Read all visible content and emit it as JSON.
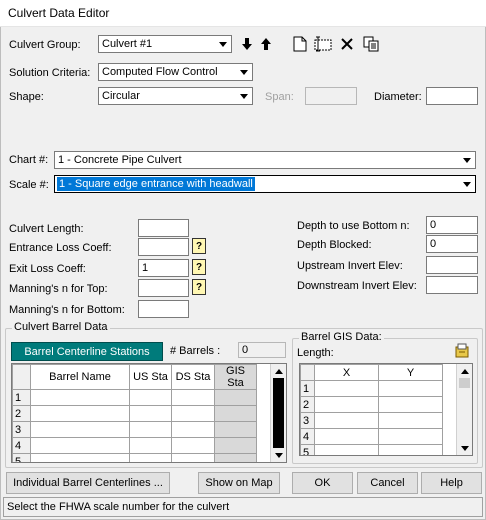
{
  "window": {
    "title": "Culvert Data Editor"
  },
  "culvert_group": {
    "label": "Culvert Group:",
    "value": "Culvert #1"
  },
  "toolbar": {
    "icons": [
      "arrow-down-icon",
      "arrow-up-icon",
      "new-document-icon",
      "rename-icon",
      "delete-icon",
      "copy-icon"
    ]
  },
  "solution_criteria": {
    "label": "Solution Criteria:",
    "value": "Computed Flow Control"
  },
  "shape": {
    "label": "Shape:",
    "value": "Circular"
  },
  "span": {
    "label": "Span:",
    "value": ""
  },
  "diameter": {
    "label": "Diameter:",
    "value": ""
  },
  "chart": {
    "label": "Chart #:",
    "value": "1 - Concrete Pipe Culvert"
  },
  "scale": {
    "label": "Scale #:",
    "value": "1 - Square edge entrance with headwall"
  },
  "fields_left": {
    "culvert_length": {
      "label": "Culvert Length:",
      "value": ""
    },
    "entrance_loss": {
      "label": "Entrance Loss Coeff:",
      "value": ""
    },
    "exit_loss": {
      "label": "Exit Loss Coeff:",
      "value": "1"
    },
    "mannings_top": {
      "label": "Manning's n for Top:",
      "value": ""
    },
    "mannings_bottom": {
      "label": "Manning's n for Bottom:",
      "value": ""
    },
    "help_glyph": "?"
  },
  "fields_right": {
    "depth_bottom_n": {
      "label": "Depth to use Bottom n:",
      "value": "0"
    },
    "depth_blocked": {
      "label": "Depth Blocked:",
      "value": "0"
    },
    "us_invert": {
      "label": "Upstream Invert Elev:",
      "value": ""
    },
    "ds_invert": {
      "label": "Downstream Invert Elev:",
      "value": ""
    }
  },
  "barrel_data": {
    "group_title": "Culvert Barrel Data",
    "centerline_button": "Barrel Centerline Stations",
    "barrels_label": "# Barrels :",
    "barrels_value": "0",
    "columns": [
      "Barrel Name",
      "US Sta",
      "DS Sta",
      "GIS Sta"
    ],
    "rows": [
      "1",
      "2",
      "3",
      "4",
      "5"
    ]
  },
  "gis_data": {
    "group_title": "Barrel GIS Data:",
    "length_label": "Length:",
    "columns": [
      "X",
      "Y"
    ],
    "rows": [
      "1",
      "2",
      "3",
      "4",
      "5"
    ]
  },
  "buttons": {
    "individual": "Individual Barrel Centerlines ...",
    "show_map": "Show on Map",
    "ok": "OK",
    "cancel": "Cancel",
    "help": "Help"
  },
  "status": "Select the FHWA scale number for the culvert"
}
